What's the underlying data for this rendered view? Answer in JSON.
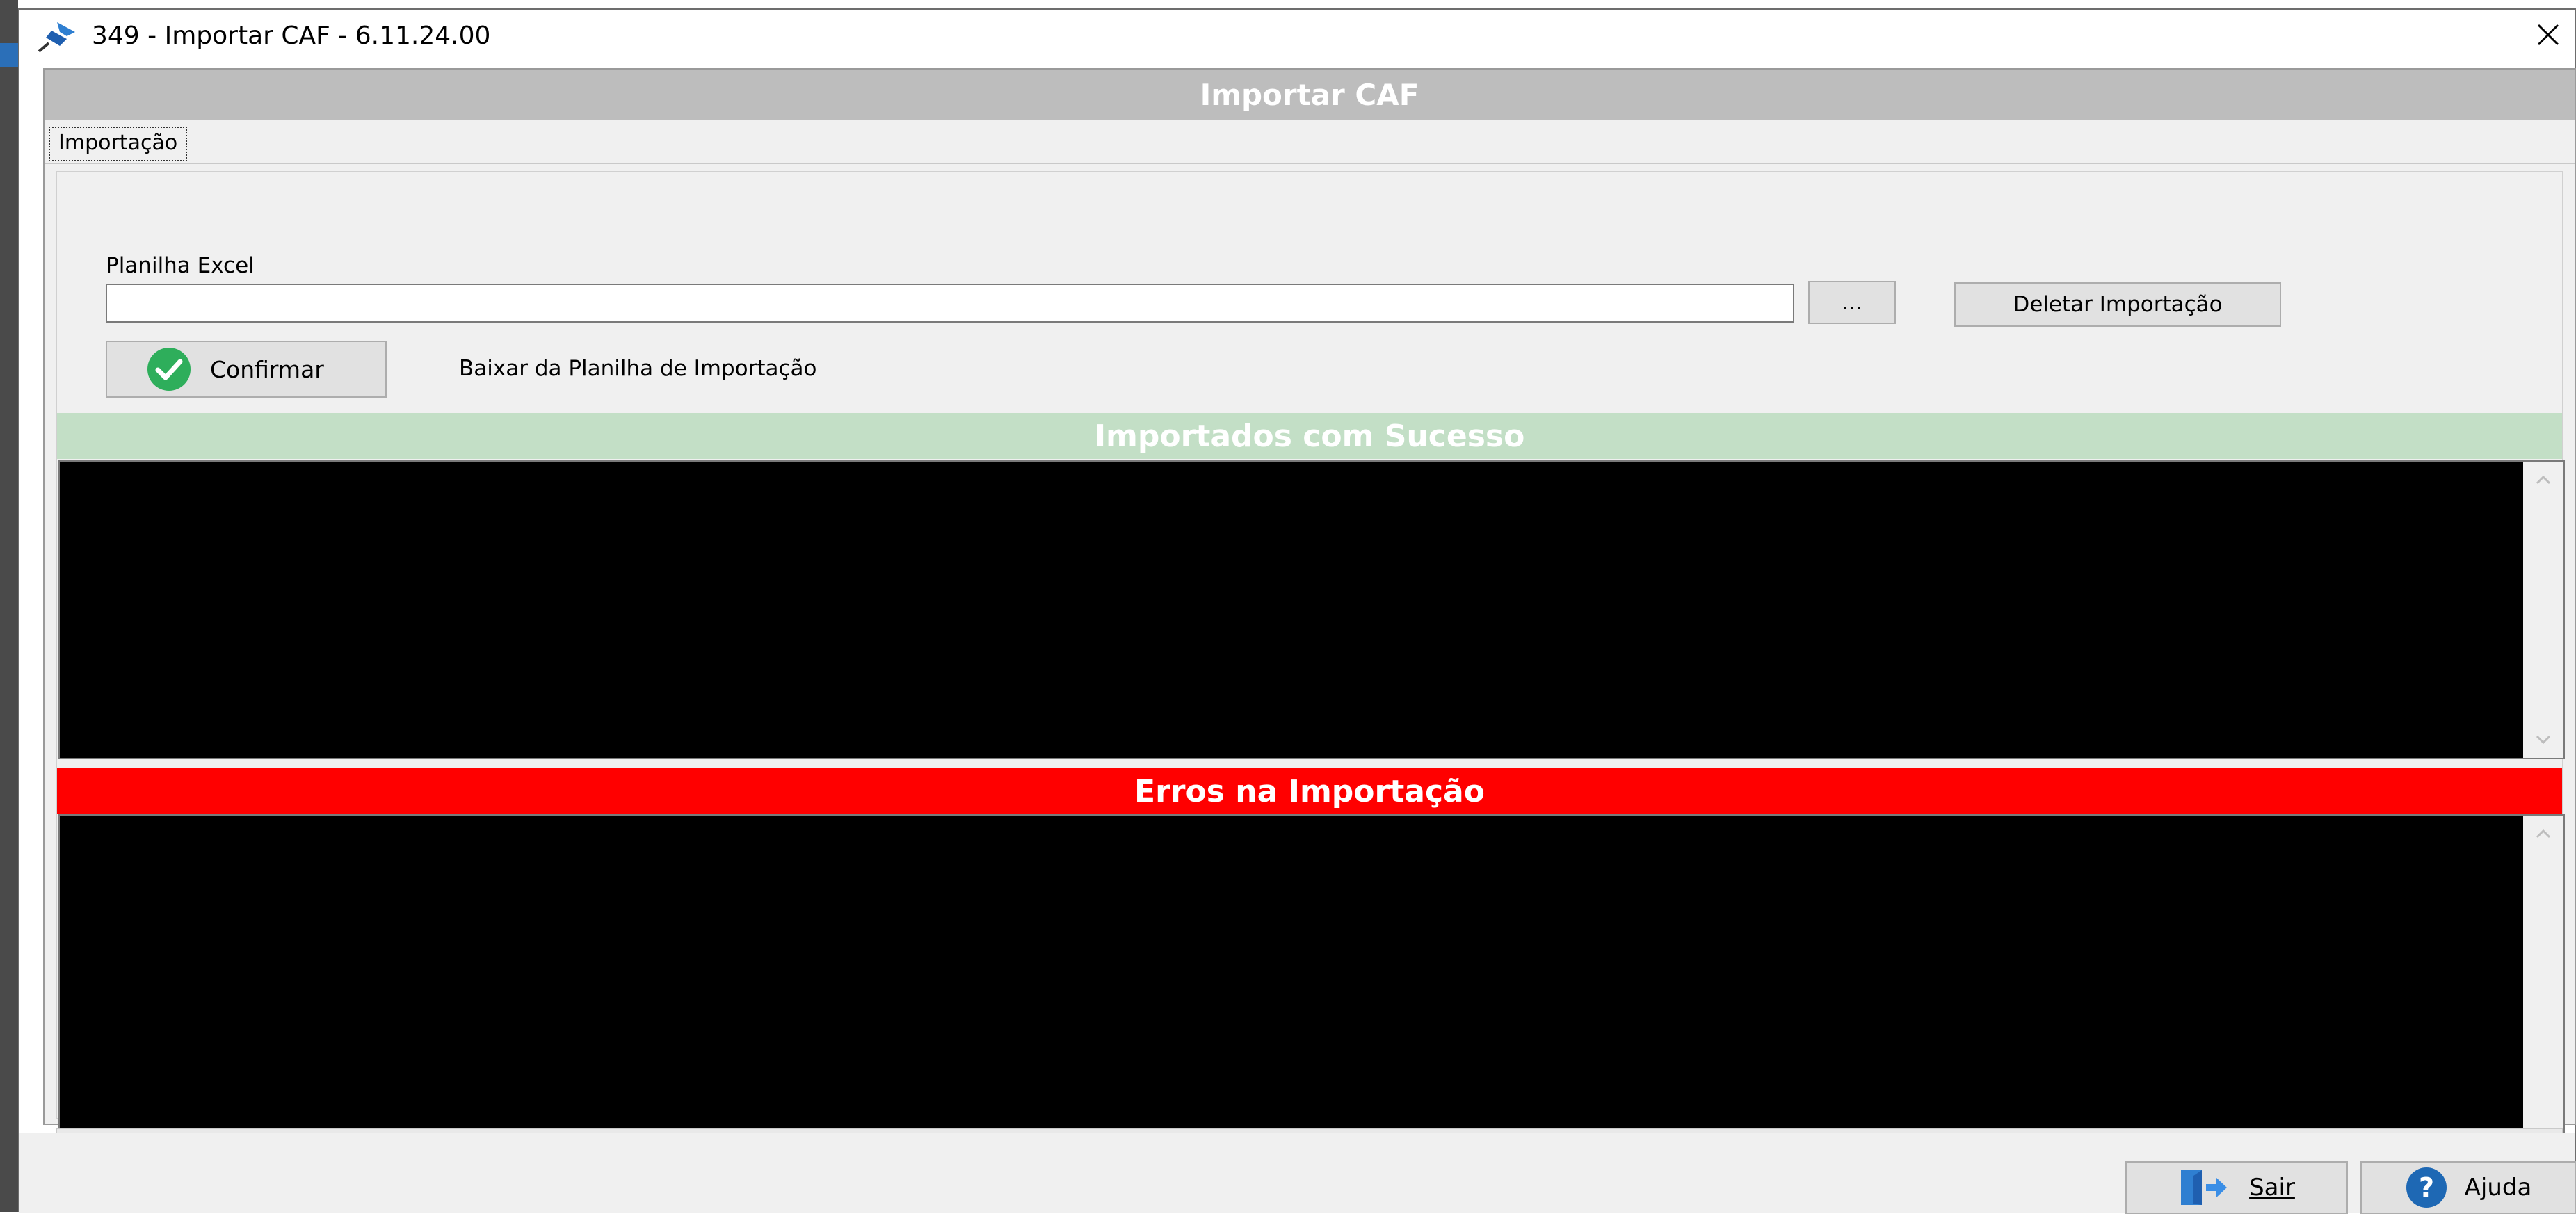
{
  "window": {
    "title": "349 - Importar CAF - 6.11.24.00"
  },
  "header": {
    "title": "Importar CAF"
  },
  "tabs": [
    {
      "label": "Importação"
    }
  ],
  "form": {
    "file_label": "Planilha Excel",
    "file_value": "",
    "browse_label": "...",
    "delete_label": "Deletar Importação",
    "confirm_label": "Confirmar",
    "download_label": "Baixar da Planilha de Importação"
  },
  "sections": {
    "success_title": "Importados com Sucesso",
    "errors_title": "Erros na Importação"
  },
  "footer": {
    "exit_label": "Sair",
    "help_label": "Ajuda"
  },
  "colors": {
    "header_bg": "#bdbdbd",
    "success_bg": "#c3dfc6",
    "error_bg": "#ff0000",
    "list_bg": "#000000",
    "confirm_icon": "#2eae5b",
    "help_icon": "#1e68b4",
    "exit_icon": "#3a7bd5"
  },
  "icons": {
    "app": "pin-icon",
    "close": "close-icon",
    "confirm": "check-circle-icon",
    "exit": "exit-door-icon",
    "help": "help-circle-icon"
  }
}
